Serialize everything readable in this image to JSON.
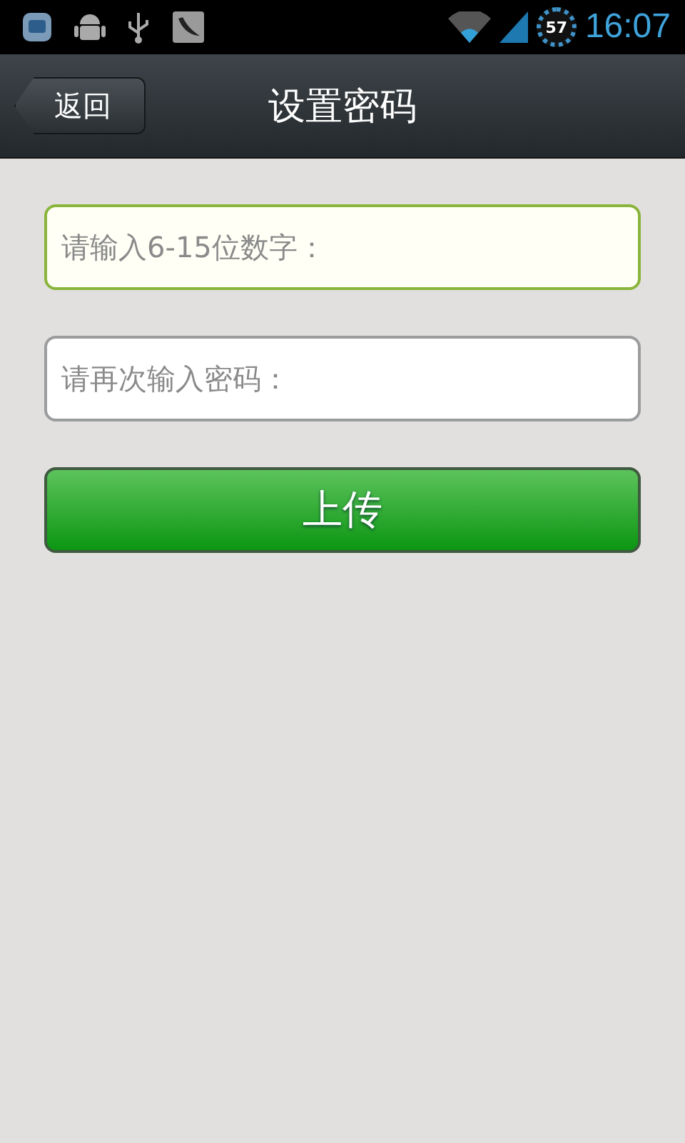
{
  "status_bar": {
    "battery": "57",
    "time": "16:07"
  },
  "header": {
    "back": "返回",
    "title": "设置密码"
  },
  "fields": [
    {
      "placeholder": "请输入6-15位数字：",
      "focused": true
    },
    {
      "placeholder": "请再次输入密码：",
      "focused": false
    }
  ],
  "submit": "上传"
}
